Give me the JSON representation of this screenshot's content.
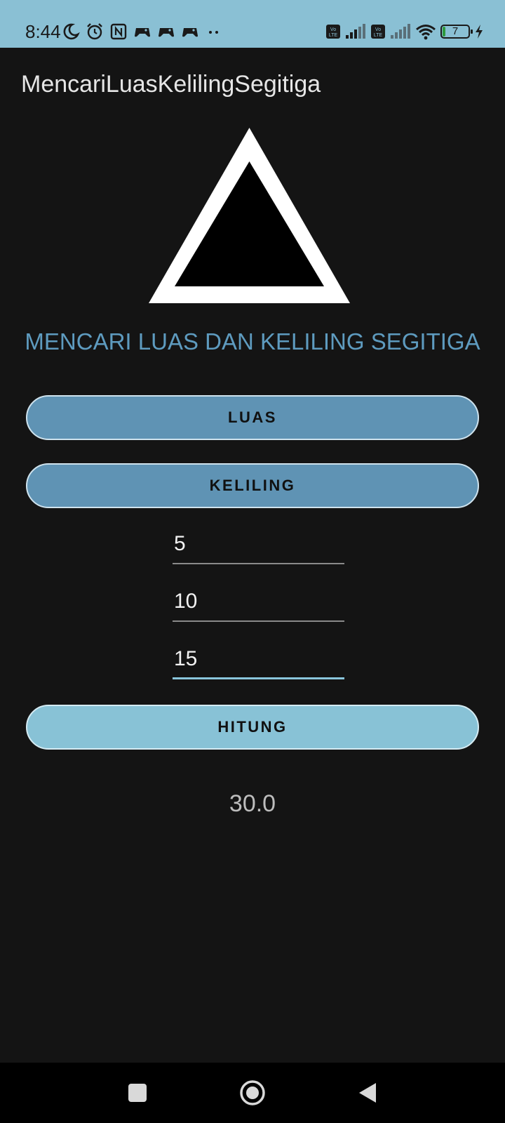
{
  "status_bar": {
    "time": "8:44",
    "battery_level": "7",
    "left_icons": [
      "moon-icon",
      "alarm-icon",
      "nfc-icon",
      "game-icon",
      "game-icon",
      "game-icon",
      "more-dots-icon"
    ],
    "right_icons": [
      "volte-icon",
      "signal-icon",
      "volte-icon",
      "signal-icon",
      "wifi-icon",
      "battery-icon",
      "charging-icon"
    ]
  },
  "app_bar": {
    "title": "MencariLuasKelilingSegitiga"
  },
  "main": {
    "heading": "MENCARI LUAS DAN KELILING SEGITIGA",
    "luas_button": "LUAS",
    "keliling_button": "KELILING",
    "input_1_value": "5",
    "input_2_value": "10",
    "input_3_value": "15",
    "hitung_button": "HITUNG",
    "result": "30.0"
  },
  "colors": {
    "status_bar_bg": "#8ac0d4",
    "background": "#141414",
    "heading": "#5e9bbf",
    "button_primary": "#5f93b4",
    "button_accent": "#88c2d6",
    "focus_underline": "#8ac6dc"
  },
  "navigation_bar": {
    "icons": [
      "square-recents-icon",
      "circle-home-icon",
      "triangle-back-icon"
    ]
  }
}
